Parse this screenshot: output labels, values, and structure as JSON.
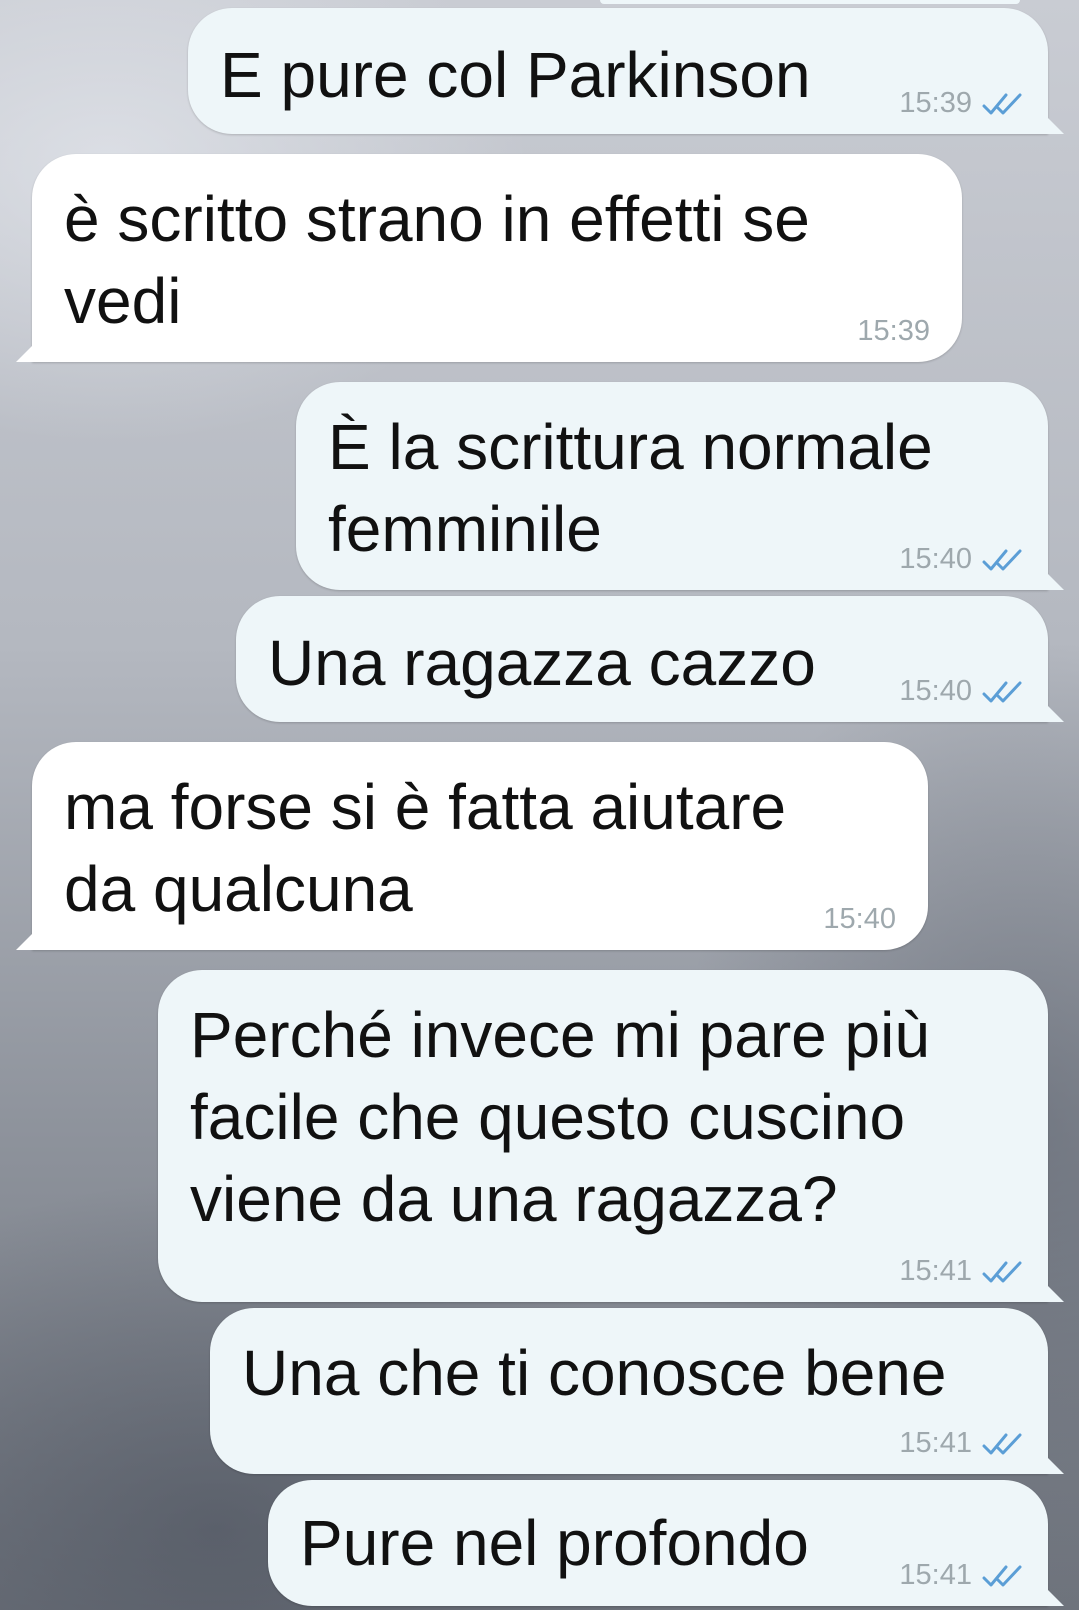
{
  "colors": {
    "outgoing_bubble": "#eef6f9",
    "incoming_bubble": "#ffffff",
    "time_text": "#9ea8ad",
    "read_check": "#5b9ed6"
  },
  "messages": [
    {
      "direction": "out",
      "text": "E pure col Parkinson",
      "time": "15:39",
      "status_icon": "double-check-icon"
    },
    {
      "direction": "in",
      "text": "è scritto strano in effetti se\nvedi",
      "time": "15:39"
    },
    {
      "direction": "out",
      "text": "È la scrittura normale\nfemminile",
      "time": "15:40",
      "status_icon": "double-check-icon"
    },
    {
      "direction": "out",
      "text": "Una ragazza cazzo",
      "time": "15:40",
      "status_icon": "double-check-icon"
    },
    {
      "direction": "in",
      "text": "ma forse si è fatta aiutare\nda qualcuna",
      "time": "15:40"
    },
    {
      "direction": "out",
      "text": "Perché invece mi pare più\nfacile che questo cuscino\nviene da una ragazza?",
      "time": "15:41",
      "status_icon": "double-check-icon"
    },
    {
      "direction": "out",
      "text": "Una che ti conosce bene",
      "time": "15:41",
      "status_icon": "double-check-icon"
    },
    {
      "direction": "out",
      "text": "Pure nel profondo",
      "time": "15:41",
      "status_icon": "double-check-icon"
    }
  ]
}
